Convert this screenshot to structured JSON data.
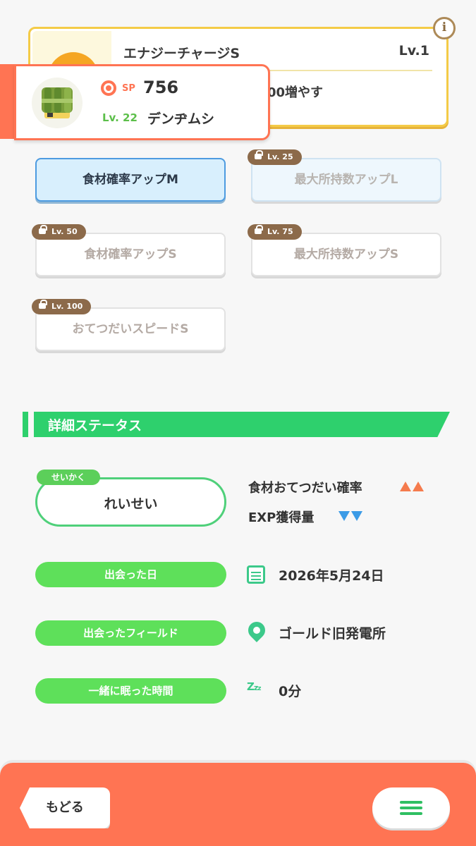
{
  "main_skill": {
    "name": "エナジーチャージS",
    "level": "Lv.1",
    "description_fragment": "00増やす"
  },
  "pokemon": {
    "sp_label": "SP",
    "sp_value": "756",
    "level": "Lv. 22",
    "name": "デンヂムシ"
  },
  "sub_skills": [
    {
      "label": "食材確率アップM",
      "state": "unlocked",
      "lock_level": ""
    },
    {
      "label": "最大所持数アップL",
      "state": "locked",
      "lock_level": "Lv. 25"
    },
    {
      "label": "食材確率アップS",
      "state": "locked",
      "lock_level": "Lv. 50"
    },
    {
      "label": "最大所持数アップS",
      "state": "locked",
      "lock_level": "Lv. 75"
    },
    {
      "label": "おてつだいスピードS",
      "state": "locked",
      "lock_level": "Lv. 100"
    }
  ],
  "details": {
    "section_title": "詳細ステータス",
    "nature_tag": "せいかく",
    "nature_value": "れいせい",
    "nature_up_label": "食材おてつだい確率",
    "nature_down_label": "EXP獲得量",
    "met_date_label": "出会った日",
    "met_date_value": "2026年5月24日",
    "met_field_label": "出会ったフィールド",
    "met_field_value": "ゴールド旧発電所",
    "slept_label": "一緒に眠った時間",
    "slept_value": "0分"
  },
  "footer": {
    "back_label": "もどる"
  },
  "icons": {
    "info": "info-icon",
    "skill": "energy-charge-icon",
    "sp": "sp-icon",
    "lock": "lock-icon",
    "calendar": "calendar-icon",
    "location": "location-pin-icon",
    "sleep": "zzz-icon",
    "menu": "hamburger-menu-icon"
  },
  "colors": {
    "accent_orange": "#ff7453",
    "accent_green": "#2ed06d",
    "skill_border": "#f4cb47",
    "active_sub_skill": "#d8effd",
    "lock_tag": "#8c6a4a",
    "stat_up": "#f57b4d",
    "stat_down": "#3c9be6"
  }
}
